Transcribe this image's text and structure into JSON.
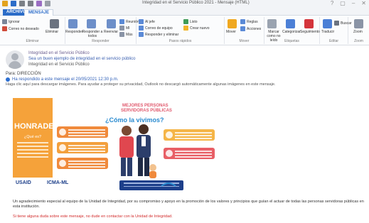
{
  "titlebar": {
    "title": "Integridad en el Servicio Público 2021 - Mensaje (HTML)",
    "qa_icon_colors": [
      "#e2a21c",
      "#2b6cc8",
      "#7a7f86",
      "#7a7f86",
      "#9a6dc2",
      "#9aa0a8"
    ]
  },
  "tabs": {
    "file": "ARCHIVO",
    "message": "MENSAJE"
  },
  "ribbon": {
    "groups": [
      {
        "label": "Eliminar"
      },
      {
        "label": "Responder"
      },
      {
        "label": "Pasos rápidos"
      },
      {
        "label": "Mover"
      },
      {
        "label": "Etiquetas"
      },
      {
        "label": "Editar"
      },
      {
        "label": "Zoom"
      }
    ],
    "buttons": {
      "ignore": "Ignorar",
      "junk": "Correo no deseado",
      "delete": "Eliminar",
      "reply": "Responder",
      "reply_all": "Responder a todos",
      "forward": "Reenviar",
      "meeting": "Reunión",
      "im": "MI",
      "more": "Más",
      "to_manager": "Al jefe",
      "team_email": "Correo de equipo",
      "done": "Listo",
      "reply_delete": "Responder y eliminar",
      "create_new": "Crear nuevo",
      "move": "Mover",
      "rules": "Reglas",
      "actions": "Acciones",
      "mark_unread": "Marcar como no leído",
      "categorize": "Categorizar",
      "followup": "Seguimiento",
      "translate": "Traducir",
      "find": "Buscar",
      "zoom": "Zoom"
    }
  },
  "header": {
    "from": "Integridad en el Servicio Público",
    "subject": "Sea un buen ejemplo de integridad en el servicio público",
    "sender_line": "Integridad en el Servicio Público",
    "to_label": "Para:",
    "to_value": "DIRECCIÓN",
    "info": "Ha respondido a este mensaje el 20/05/2021 12:30 p.m.",
    "forwarded": "Haga clic aquí para descargar imágenes. Para ayudar a proteger su privacidad, Outlook no descargó automáticamente algunas imágenes en este mensaje."
  },
  "poster": {
    "left_title": "HONRADEZ",
    "left_sub": "¿Qué es?",
    "title_line1": "MEJORES PERSONAS",
    "title_line2": "SERVIDORAS PÚBLICAS",
    "title_line3": "¿Cómo la vivimos?",
    "logo1": "USAID",
    "logo2": "ICMA-ML",
    "colors": {
      "left": "#f5a23a",
      "card1": "#f08a3c",
      "card2": "#f3a03d",
      "card3": "#f08a3c",
      "card4": "#f5b547",
      "card5": "#e85f66"
    }
  },
  "body": {
    "paragraph": "Un agradecimiento especial al equipo de la Unidad de Integridad, por su compromiso y apoyo en la promoción de los valores y principios que guían el actuar de todas las personas servidoras públicas en esta institución.",
    "red_note": "Si tiene alguna duda sobre este mensaje, no dude en contactar con la Unidad de Integridad."
  }
}
